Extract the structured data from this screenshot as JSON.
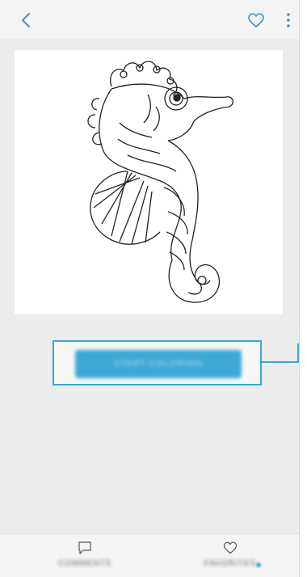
{
  "topbar": {
    "back_icon": "chevron-left-icon",
    "like_icon": "heart-outline-icon",
    "more_icon": "more-vertical-icon"
  },
  "artwork": {
    "description_icon": "seahorse-coloring-page"
  },
  "main": {
    "start_button_label": "START COLORING"
  },
  "bottom_bar": {
    "comments_label": "COMMENTS",
    "comments_icon": "comment-icon",
    "favorites_label": "FAVORITES",
    "favorites_icon": "heart-outline-icon"
  },
  "colors": {
    "accent": "#3ea8d6",
    "highlight": "#3aa7cf",
    "background": "#ececec",
    "bar": "#f4f4f4"
  }
}
